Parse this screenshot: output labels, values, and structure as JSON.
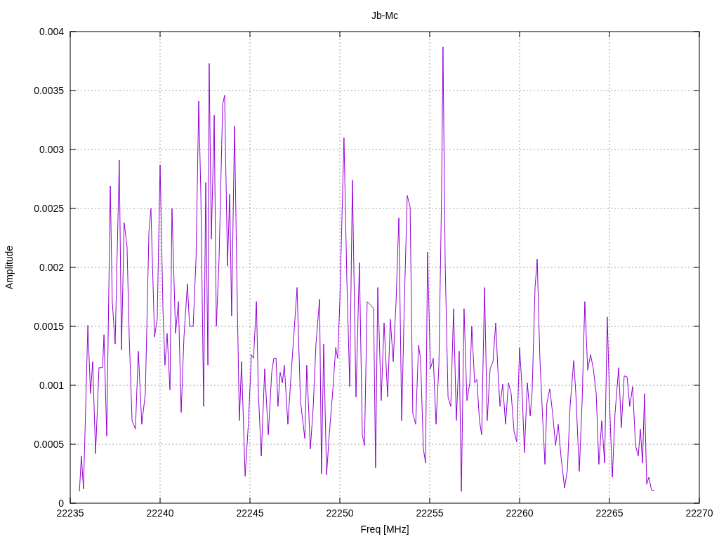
{
  "chart_data": {
    "type": "line",
    "grid": true,
    "title": "Jb-Mc",
    "xlabel": "Freq [MHz]",
    "ylabel": "Amplitude",
    "xlim": [
      22235,
      22270
    ],
    "ylim": [
      0,
      0.004
    ],
    "xticks": [
      22235,
      22240,
      22245,
      22250,
      22255,
      22260,
      22265,
      22270
    ],
    "yticks": [
      0,
      0.0005,
      0.001,
      0.0015,
      0.002,
      0.0025,
      0.003,
      0.0035,
      0.004
    ],
    "x": [
      22235.51,
      22235.62,
      22235.74,
      22235.98,
      22236.13,
      22236.25,
      22236.41,
      22236.6,
      22236.8,
      22236.88,
      22237.03,
      22237.23,
      22237.34,
      22237.5,
      22237.73,
      22237.85,
      22238.0,
      22238.16,
      22238.28,
      22238.44,
      22238.63,
      22238.79,
      22238.98,
      22239.18,
      22239.38,
      22239.49,
      22239.69,
      22239.84,
      22240.0,
      22240.16,
      22240.27,
      22240.39,
      22240.55,
      22240.66,
      22240.86,
      22241.02,
      22241.17,
      22241.33,
      22241.52,
      22241.64,
      22241.84,
      22242.0,
      22242.15,
      22242.27,
      22242.42,
      22242.54,
      22242.66,
      22242.73,
      22242.85,
      22243.01,
      22243.13,
      22243.28,
      22243.48,
      22243.59,
      22243.75,
      22243.87,
      22243.98,
      22244.14,
      22244.3,
      22244.41,
      22244.53,
      22244.73,
      22244.92,
      22245.08,
      22245.2,
      22245.36,
      22245.47,
      22245.63,
      22245.82,
      22246.02,
      22246.21,
      22246.33,
      22246.45,
      22246.56,
      22246.68,
      22246.8,
      22246.91,
      22247.11,
      22247.27,
      22247.46,
      22247.62,
      22247.81,
      22248.05,
      22248.16,
      22248.36,
      22248.52,
      22248.67,
      22248.87,
      22248.98,
      22249.1,
      22249.26,
      22249.41,
      22249.61,
      22249.77,
      22249.88,
      22250.0,
      22250.23,
      22250.39,
      22250.55,
      22250.7,
      22250.9,
      22251.09,
      22251.25,
      22251.37,
      22251.52,
      22251.72,
      22251.88,
      22251.99,
      22252.11,
      22252.3,
      22252.46,
      22252.66,
      22252.81,
      22252.97,
      22253.13,
      22253.28,
      22253.44,
      22253.59,
      22253.75,
      22253.91,
      22254.06,
      22254.22,
      22254.38,
      22254.49,
      22254.65,
      22254.77,
      22254.88,
      22255.04,
      22255.2,
      22255.35,
      22255.51,
      22255.66,
      22255.74,
      22255.86,
      22256.02,
      22256.17,
      22256.33,
      22256.48,
      22256.64,
      22256.76,
      22256.91,
      22257.07,
      22257.23,
      22257.34,
      22257.5,
      22257.62,
      22257.77,
      22257.89,
      22258.05,
      22258.2,
      22258.36,
      22258.52,
      22258.67,
      22258.79,
      22258.91,
      22259.06,
      22259.22,
      22259.38,
      22259.53,
      22259.69,
      22259.84,
      22260.0,
      22260.12,
      22260.27,
      22260.43,
      22260.59,
      22260.7,
      22260.86,
      22260.98,
      22261.13,
      22261.29,
      22261.41,
      22261.52,
      22261.68,
      22261.84,
      22262.0,
      22262.15,
      22262.3,
      22262.5,
      22262.66,
      22262.81,
      22263.01,
      22263.13,
      22263.32,
      22263.48,
      22263.63,
      22263.79,
      22263.95,
      22264.1,
      22264.26,
      22264.41,
      22264.57,
      22264.73,
      22264.88,
      22265.04,
      22265.16,
      22265.31,
      22265.51,
      22265.66,
      22265.82,
      22265.98,
      22266.13,
      22266.29,
      22266.45,
      22266.6,
      22266.72,
      22266.84,
      22266.95,
      22267.07,
      22267.19,
      22267.34,
      22267.5
    ],
    "series": [
      {
        "color": "#9400d3",
        "values": [
          0.0001,
          0.0004,
          0.00012,
          0.00151,
          0.00093,
          0.0012,
          0.00042,
          0.00115,
          0.00115,
          0.00143,
          0.00057,
          0.00269,
          0.00171,
          0.00135,
          0.00291,
          0.0013,
          0.00238,
          0.00218,
          0.00142,
          0.0007,
          0.00063,
          0.00129,
          0.00067,
          0.00093,
          0.0023,
          0.0025,
          0.00141,
          0.00156,
          0.00287,
          0.00164,
          0.00117,
          0.00144,
          0.00096,
          0.0025,
          0.00144,
          0.00171,
          0.00077,
          0.00141,
          0.00186,
          0.0015,
          0.0015,
          0.00207,
          0.00341,
          0.00261,
          0.00082,
          0.00272,
          0.00117,
          0.00373,
          0.00224,
          0.00329,
          0.0015,
          0.00207,
          0.00338,
          0.00346,
          0.00201,
          0.00262,
          0.00159,
          0.0032,
          0.00165,
          0.0007,
          0.0012,
          0.00023,
          0.0007,
          0.00126,
          0.00123,
          0.00171,
          0.00093,
          0.0004,
          0.00114,
          0.00058,
          0.00111,
          0.00123,
          0.00123,
          0.00082,
          0.00111,
          0.00102,
          0.00117,
          0.00067,
          0.00105,
          0.00147,
          0.00183,
          0.00087,
          0.00055,
          0.00117,
          0.00046,
          0.00082,
          0.00135,
          0.00173,
          0.00025,
          0.00135,
          0.00024,
          0.00058,
          0.00096,
          0.00132,
          0.00123,
          0.00171,
          0.0031,
          0.00189,
          0.00099,
          0.00274,
          0.0009,
          0.00204,
          0.00058,
          0.00049,
          0.00171,
          0.00168,
          0.00165,
          0.0003,
          0.00183,
          0.00087,
          0.00153,
          0.0009,
          0.00156,
          0.0012,
          0.00171,
          0.00242,
          0.0007,
          0.00171,
          0.00261,
          0.00251,
          0.00076,
          0.00067,
          0.00134,
          0.00123,
          0.00046,
          0.00034,
          0.00213,
          0.00114,
          0.00123,
          0.00067,
          0.00117,
          0.00261,
          0.00387,
          0.00204,
          0.0009,
          0.00082,
          0.00165,
          0.0007,
          0.00129,
          0.0001,
          0.00165,
          0.00087,
          0.00102,
          0.0015,
          0.00102,
          0.00105,
          0.0007,
          0.00058,
          0.00183,
          0.0007,
          0.00114,
          0.0012,
          0.00153,
          0.00114,
          0.00082,
          0.00101,
          0.00067,
          0.00102,
          0.00093,
          0.00061,
          0.00052,
          0.00132,
          0.00102,
          0.00043,
          0.00102,
          0.00074,
          0.00095,
          0.00183,
          0.00207,
          0.00123,
          0.0007,
          0.00033,
          0.00085,
          0.00097,
          0.00076,
          0.00049,
          0.00067,
          0.0004,
          0.00013,
          0.00028,
          0.00082,
          0.00121,
          0.00093,
          0.00027,
          0.00087,
          0.00171,
          0.00113,
          0.00126,
          0.00114,
          0.00093,
          0.00033,
          0.0007,
          0.00034,
          0.00158,
          0.0007,
          0.00022,
          0.00076,
          0.00115,
          0.00064,
          0.00108,
          0.00107,
          0.00082,
          0.00099,
          0.00049,
          0.0004,
          0.00063,
          0.00034,
          0.00093,
          0.00016,
          0.00022,
          0.00011,
          0.00011
        ]
      }
    ]
  }
}
